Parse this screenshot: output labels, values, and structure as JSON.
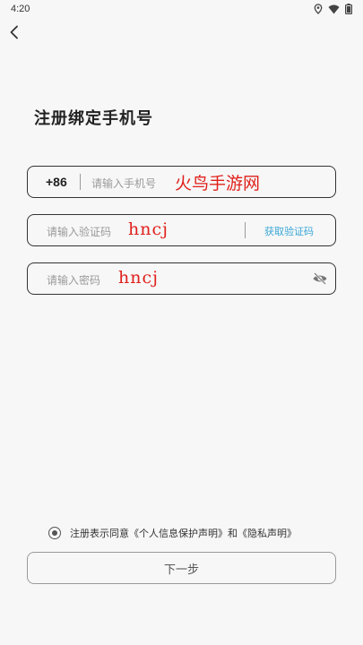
{
  "status_bar": {
    "time": "4:20",
    "icons": [
      "location-icon",
      "wifi-icon",
      "battery-icon"
    ]
  },
  "header": {
    "back_icon": "chevron-left-icon"
  },
  "page": {
    "title": "注册绑定手机号"
  },
  "phone_field": {
    "country_code": "+86",
    "placeholder": "请输入手机号",
    "overlay_text": "火鸟手游网"
  },
  "code_field": {
    "placeholder": "请输入验证码",
    "overlay_text": "hncj",
    "get_code_label": "获取验证码"
  },
  "password_field": {
    "placeholder": "请输入密码",
    "overlay_text": "hncj",
    "toggle_icon": "eye-off-icon"
  },
  "agreement": {
    "text": "注册表示同意《个人信息保护声明》和《隐私声明》"
  },
  "next_button": {
    "label": "下一步"
  },
  "colors": {
    "accent_link": "#3aa7d6",
    "overlay_red": "#e0201c",
    "background": "#f7f7f7"
  }
}
